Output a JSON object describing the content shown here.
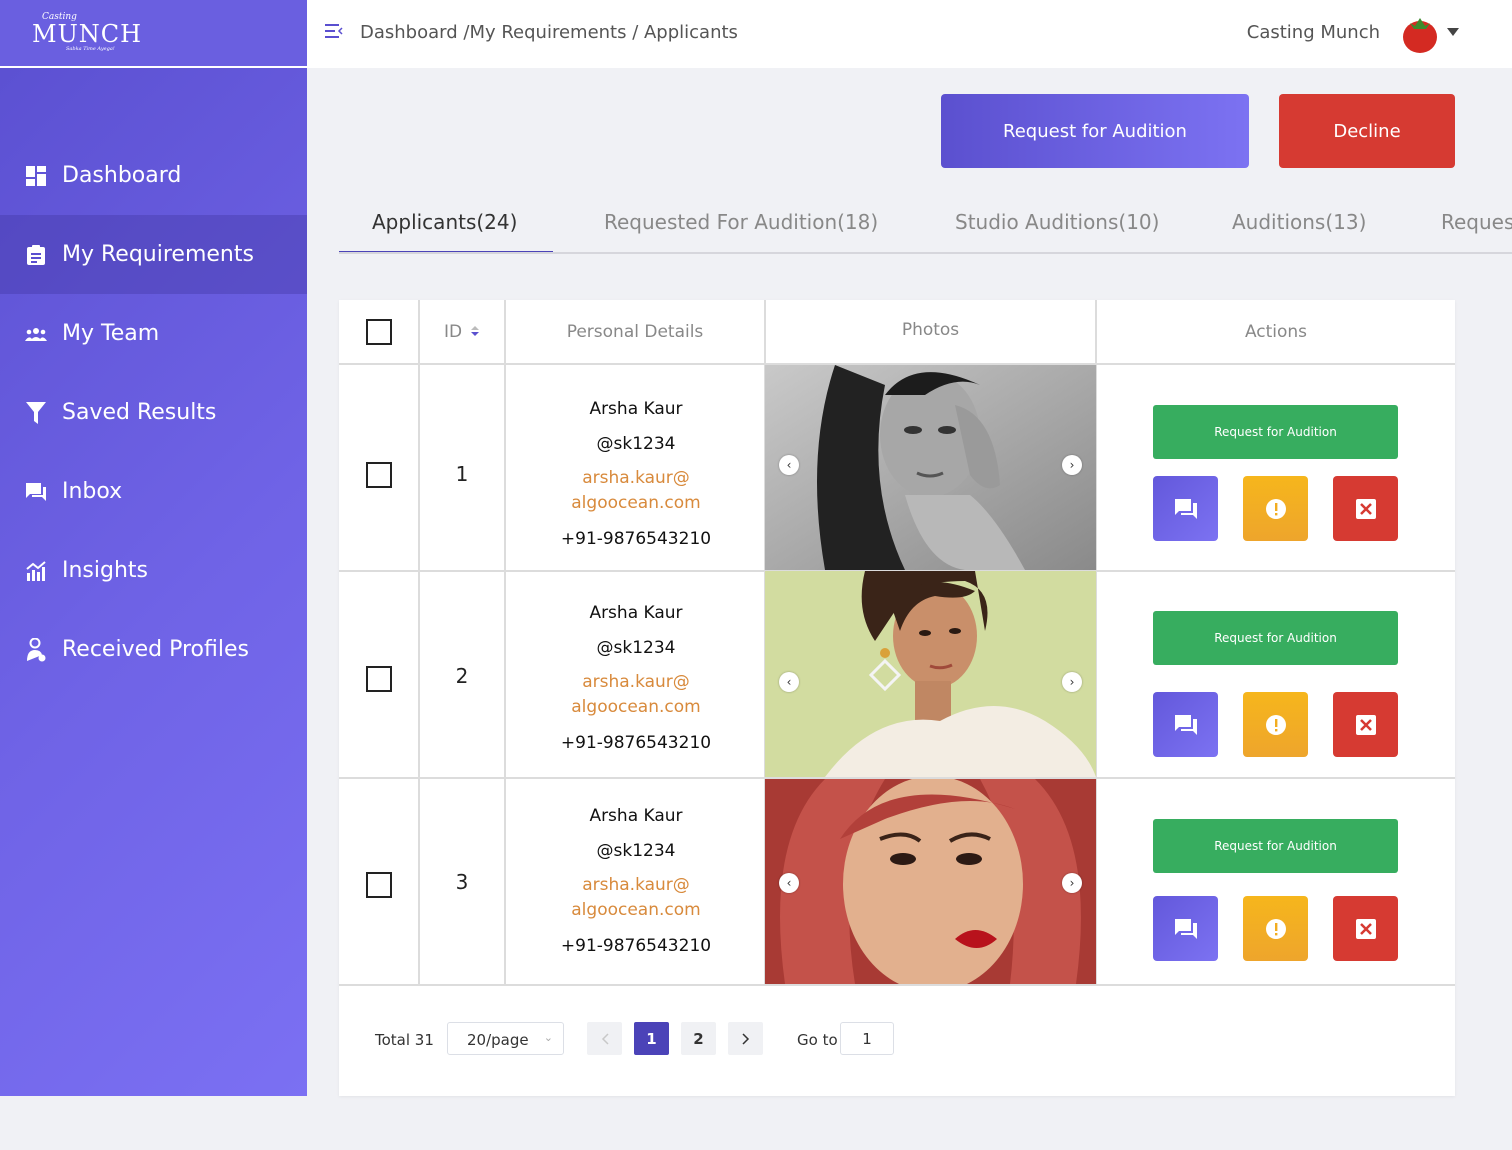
{
  "brand": {
    "small": "Casting",
    "name": "MUNCH",
    "tagline": "Sabka Time Ayega!"
  },
  "header": {
    "breadcrumb": "Dashboard /My Requirements / Applicants",
    "user_name": "Casting Munch"
  },
  "sidebar": {
    "items": [
      {
        "label": "Dashboard",
        "icon": "dashboard-icon"
      },
      {
        "label": "My Requirements",
        "icon": "clipboard-icon",
        "active": true
      },
      {
        "label": "My Team",
        "icon": "team-icon"
      },
      {
        "label": "Saved Results",
        "icon": "filter-icon"
      },
      {
        "label": "Inbox",
        "icon": "inbox-icon"
      },
      {
        "label": "Insights",
        "icon": "insights-icon"
      },
      {
        "label": "Received Profiles",
        "icon": "profile-icon"
      }
    ]
  },
  "actions": {
    "request_audition": "Request for Audition",
    "decline": "Decline"
  },
  "tabs": [
    {
      "label": "Applicants(24)",
      "active": true
    },
    {
      "label": "Requested For Audition(18)"
    },
    {
      "label": "Studio Auditions(10)"
    },
    {
      "label": "Auditions(13)"
    },
    {
      "label": "Reques"
    }
  ],
  "table": {
    "columns": [
      "ID",
      "Personal Details",
      "Photos",
      "Actions"
    ],
    "rows": [
      {
        "id": "1",
        "name": "Arsha Kaur",
        "handle": "@sk1234",
        "email_line1": "arsha.kaur@",
        "email_line2": "algoocean.com",
        "phone": "+91-9876543210",
        "request_label": "Request for Audition"
      },
      {
        "id": "2",
        "name": "Arsha Kaur",
        "handle": "@sk1234",
        "email_line1": "arsha.kaur@",
        "email_line2": "algoocean.com",
        "phone": "+91-9876543210",
        "request_label": "Request for Audition"
      },
      {
        "id": "3",
        "name": "Arsha Kaur",
        "handle": "@sk1234",
        "email_line1": "arsha.kaur@",
        "email_line2": "algoocean.com",
        "phone": "+91-9876543210",
        "request_label": "Request for Audition"
      }
    ]
  },
  "pagination": {
    "total": "Total 31",
    "page_size": "20/page",
    "pages": [
      "1",
      "2"
    ],
    "current_page": "1",
    "goto_label": "Go to",
    "goto_value": "1"
  },
  "colors": {
    "primary": "#5b50cf",
    "accent_gradient_end": "#7c72f2",
    "danger": "#d63a32",
    "success": "#37ad5f",
    "warning": "#f6b61c",
    "email": "#d88a3c"
  }
}
